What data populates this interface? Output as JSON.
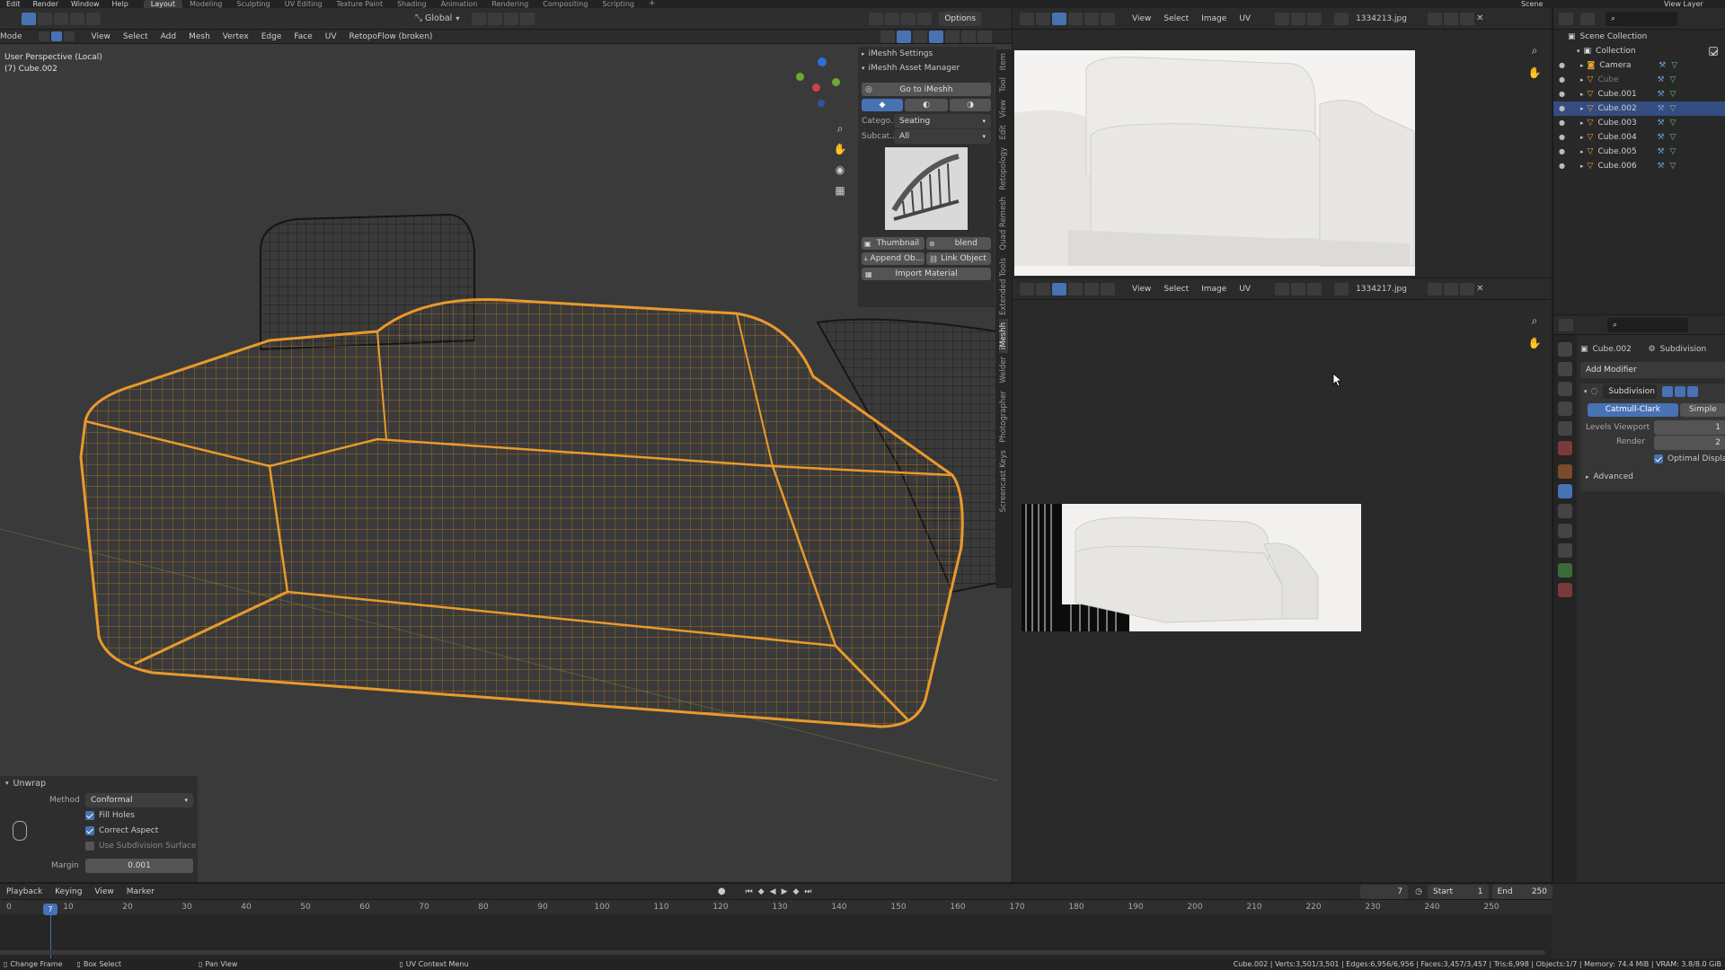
{
  "topbar": {
    "menus": [
      "Edit",
      "Render",
      "Window",
      "Help"
    ],
    "workspaces": [
      "Layout",
      "Modeling",
      "Sculpting",
      "UV Editing",
      "Texture Paint",
      "Shading",
      "Animation",
      "Rendering",
      "Compositing",
      "Scripting"
    ],
    "active_workspace": "Layout",
    "scene": "Scene",
    "view_layer": "View Layer"
  },
  "viewport": {
    "mode": "Mode",
    "menus": [
      "View",
      "Select",
      "Add",
      "Mesh",
      "Vertex",
      "Edge",
      "Face",
      "UV",
      "RetopoFlow (broken)"
    ],
    "orientation": "Global",
    "options": "Options",
    "perspective": "User Perspective (Local)",
    "object_label": "(7) Cube.002",
    "side_tabs": [
      "Item",
      "Tool",
      "View",
      "Edit",
      "Retopology",
      "Quad Remesh",
      "Extended Tools",
      "iMeshh",
      "Welder",
      "Photographer",
      "Screencast Keys"
    ]
  },
  "imeshh": {
    "settings_label": "iMeshh Settings",
    "asset_manager_label": "iMeshh Asset Manager",
    "go_to_label": "Go to iMeshh",
    "category_label": "Catego...",
    "category_value": "Seating",
    "subcategory_label": "Subcat...",
    "subcategory_value": "All",
    "thumbnail_label": "Thumbnail",
    "blend_label": "blend",
    "append_label": "Append Ob...",
    "link_label": "Link Object",
    "import_label": "Import Material"
  },
  "unwrap_panel": {
    "title": "Unwrap",
    "method_label": "Method",
    "method_value": "Conformal",
    "fill_holes": "Fill Holes",
    "correct_aspect": "Correct Aspect",
    "use_subsurf": "Use Subdivision Surface",
    "margin_label": "Margin",
    "margin_value": "0.001"
  },
  "image_editor_top": {
    "menus": [
      "View",
      "Select",
      "Image",
      "UV"
    ],
    "image_name": "1334213.jpg"
  },
  "image_editor_bottom": {
    "menus": [
      "View",
      "Select",
      "Image",
      "UV"
    ],
    "image_name": "1334217.jpg"
  },
  "outliner": {
    "header": "Scene Collection",
    "collection": "Collection",
    "items": [
      {
        "name": "Camera",
        "selected": false,
        "dim": false
      },
      {
        "name": "Cube",
        "selected": false,
        "dim": true
      },
      {
        "name": "Cube.001",
        "selected": false,
        "dim": false
      },
      {
        "name": "Cube.002",
        "selected": true,
        "dim": false
      },
      {
        "name": "Cube.003",
        "selected": false,
        "dim": false
      },
      {
        "name": "Cube.004",
        "selected": false,
        "dim": false
      },
      {
        "name": "Cube.005",
        "selected": false,
        "dim": false
      },
      {
        "name": "Cube.006",
        "selected": false,
        "dim": false
      }
    ]
  },
  "properties": {
    "object_name": "Cube.002",
    "modifier_tab": "Subdivision",
    "add_modifier": "Add Modifier",
    "modifier_name": "Subdivision",
    "catmull_clark": "Catmull-Clark",
    "simple": "Simple",
    "levels_viewport_label": "Levels Viewport",
    "levels_viewport_value": "1",
    "render_label": "Render",
    "render_value": "2",
    "optimal_display": "Optimal Display",
    "advanced": "Advanced"
  },
  "timeline": {
    "menus": [
      "Playback",
      "Keying",
      "View",
      "Marker"
    ],
    "current_frame": "7",
    "start_label": "Start",
    "start_value": "1",
    "end_label": "End",
    "end_value": "250",
    "ticks": [
      "0",
      "10",
      "20",
      "30",
      "40",
      "50",
      "60",
      "70",
      "80",
      "90",
      "100",
      "110",
      "120",
      "130",
      "140",
      "150",
      "160",
      "170",
      "180",
      "190",
      "200",
      "210",
      "220",
      "230",
      "240",
      "250"
    ],
    "current_frame_label": "7"
  },
  "statusbar": {
    "set_frame": "Change Frame",
    "box_select": "Box Select",
    "pan_view": "Pan View",
    "context_menu": "UV Context Menu",
    "stats": "Cube.002 | Verts:3,501/3,501 | Edges:6,956/6,956 | Faces:3,457/3,457 | Tris:6,998 | Objects:1/7 | Memory: 74.4 MiB | VRAM: 3.8/8.0 GiB"
  },
  "colors": {
    "accent": "#4772b3",
    "selection_orange": "#f0a030",
    "panel_bg": "#303030",
    "viewport_bg": "#3d3d3d"
  }
}
